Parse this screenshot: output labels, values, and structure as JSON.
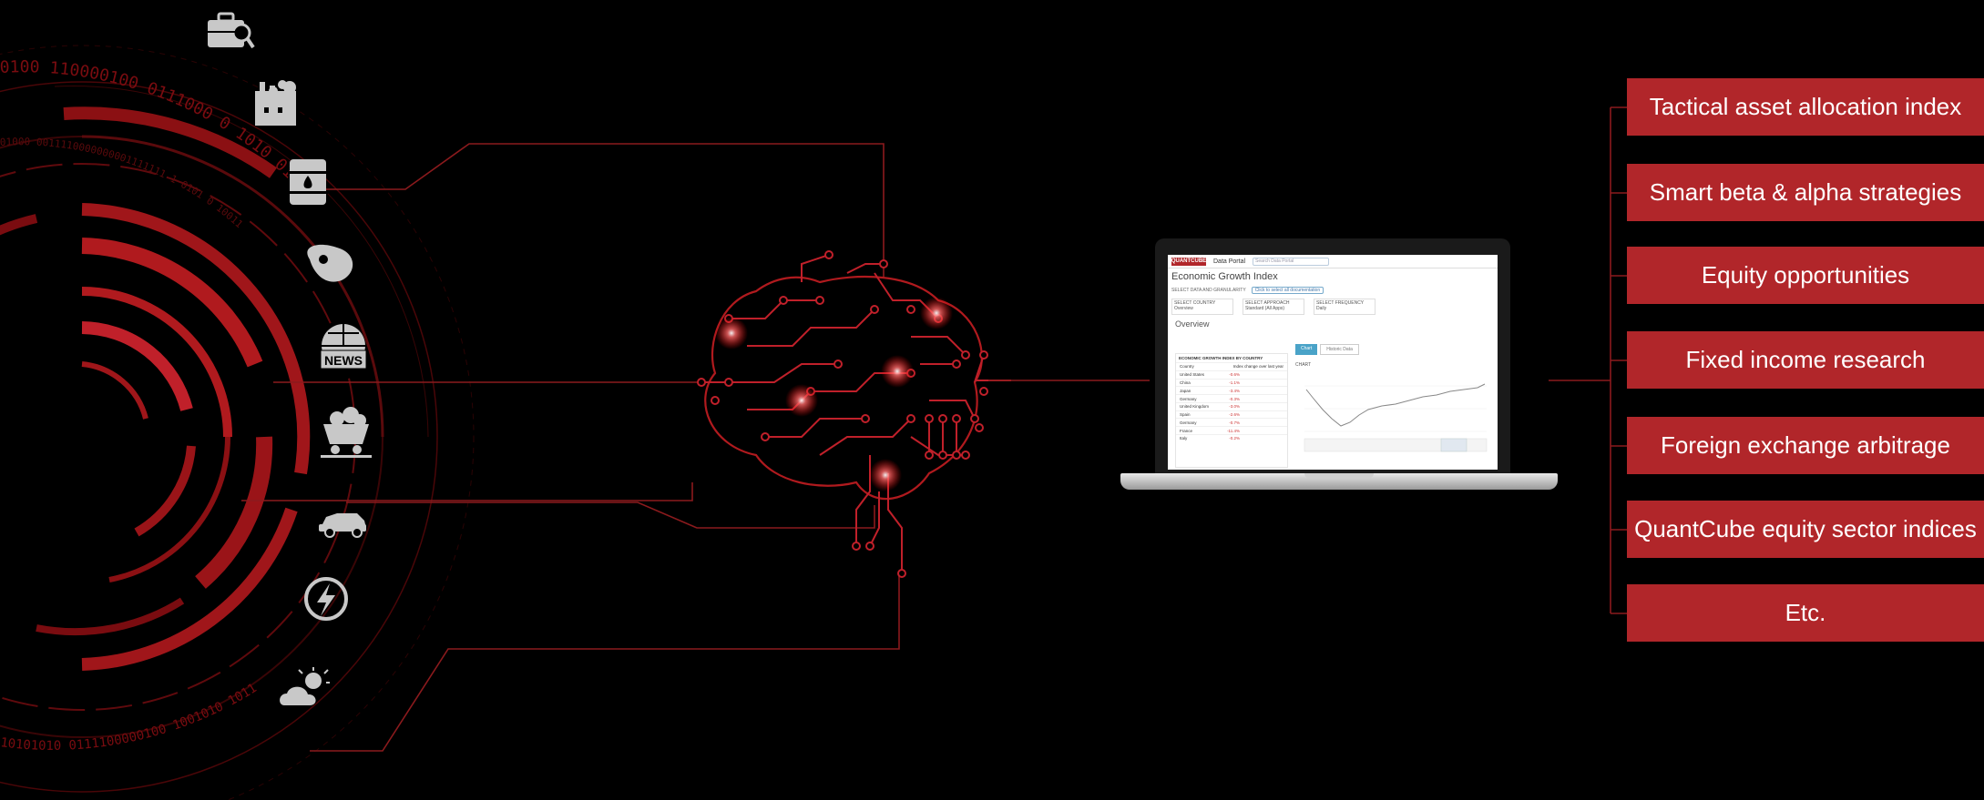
{
  "input_icons": [
    {
      "name": "briefcase-search-icon"
    },
    {
      "name": "factory-icon"
    },
    {
      "name": "oil-barrel-icon"
    },
    {
      "name": "meat-icon"
    },
    {
      "name": "news-globe-icon",
      "label": "NEWS"
    },
    {
      "name": "mining-cart-icon"
    },
    {
      "name": "car-icon"
    },
    {
      "name": "lightning-icon"
    },
    {
      "name": "weather-icon"
    }
  ],
  "binary_text": {
    "outer": "0100 110000100 0111000 0 1010 01 0100101",
    "bottom": "10101010 0111100000100 1001010 10110101101010",
    "inner": "01000 0011110000000001111111 1 0101 0 10011"
  },
  "laptop": {
    "brand": "QUANTCUBE",
    "nav_label": "Data Portal",
    "search_placeholder": "Search Data Portal",
    "page_title": "Economic Growth Index",
    "filter_label": "SELECT DATA AND GRANULARITY",
    "filter_chip": "Click to select all documentation",
    "selects": [
      {
        "label": "SELECT COUNTRY",
        "value": "Overview"
      },
      {
        "label": "SELECT APPROACH",
        "value": "Standard (All Apps)"
      },
      {
        "label": "SELECT FREQUENCY",
        "value": "Daily"
      }
    ],
    "overview_label": "Overview",
    "table_title": "ECONOMIC GROWTH INDEX BY COUNTRY",
    "table_header": [
      "Country",
      "Index change over last year"
    ],
    "table_rows": [
      {
        "country": "United States",
        "value": "-0.6%"
      },
      {
        "country": "China",
        "value": "-1.1%"
      },
      {
        "country": "Japan",
        "value": "-3.4%"
      },
      {
        "country": "Germany",
        "value": "-0.3%"
      },
      {
        "country": "United Kingdom",
        "value": "-3.0%"
      },
      {
        "country": "Spain",
        "value": "-2.6%"
      },
      {
        "country": "Germany",
        "value": "-0.7%"
      },
      {
        "country": "France",
        "value": "-11.4%"
      },
      {
        "country": "Italy",
        "value": "-0.2%"
      }
    ],
    "tabs": [
      "Chart",
      "Historic Data"
    ],
    "chart_label": "CHART"
  },
  "outputs": [
    "Tactical asset allocation index",
    "Smart beta & alpha strategies",
    "Equity opportunities",
    "Fixed income research",
    "Foreign exchange arbitrage",
    "QuantCube equity sector indices",
    "Etc."
  ],
  "colors": {
    "accent": "#b1262a",
    "dark_red": "#7a0c10",
    "line": "#8b1a1d",
    "icon": "#c8c8c8",
    "background": "#000000"
  }
}
